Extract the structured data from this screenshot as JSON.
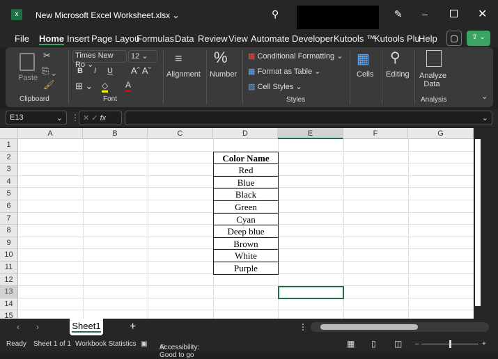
{
  "title": {
    "filename": "New Microsoft Excel Worksheet.xlsx"
  },
  "menu": [
    "File",
    "Home",
    "Insert",
    "Page Layou",
    "Formulas",
    "Data",
    "Review",
    "View",
    "Automate",
    "Developer",
    "Kutools ™",
    "Kutools Plu",
    "Help"
  ],
  "ribbon": {
    "clipboard": {
      "paste": "Paste",
      "label": "Clipboard"
    },
    "font": {
      "name": "Times New Ro",
      "size": "12",
      "label": "Font",
      "bold": "B",
      "italic": "I",
      "underline": "U"
    },
    "alignment": "Alignment",
    "number": "Number",
    "styles": {
      "conditional": "Conditional Formatting",
      "format_table": "Format as Table",
      "cell_styles": "Cell Styles",
      "label": "Styles"
    },
    "cells": "Cells",
    "editing": "Editing",
    "analyze": "Analyze Data",
    "analysis_label": "Analysis"
  },
  "formula_bar": {
    "name_box": "E13",
    "fx": "fx",
    "value": ""
  },
  "columns": [
    "A",
    "B",
    "C",
    "D",
    "E",
    "F",
    "G"
  ],
  "rows": [
    "1",
    "2",
    "3",
    "4",
    "5",
    "6",
    "7",
    "8",
    "9",
    "10",
    "11",
    "12",
    "13",
    "14",
    "15"
  ],
  "table": {
    "header": "Color Name",
    "values": [
      "Red",
      "Blue",
      "Black",
      "Green",
      "Cyan",
      "Deep blue",
      "Brown",
      "White",
      "Purple"
    ]
  },
  "selected_cell": "E13",
  "sheets": [
    "Sheet1"
  ],
  "status": {
    "ready": "Ready",
    "sheet": "Sheet 1 of 1",
    "stats": "Workbook Statistics",
    "accessibility": "Accessibility: Good to go"
  },
  "colors": {
    "accent": "#1e7145",
    "share": "#3aa562"
  }
}
